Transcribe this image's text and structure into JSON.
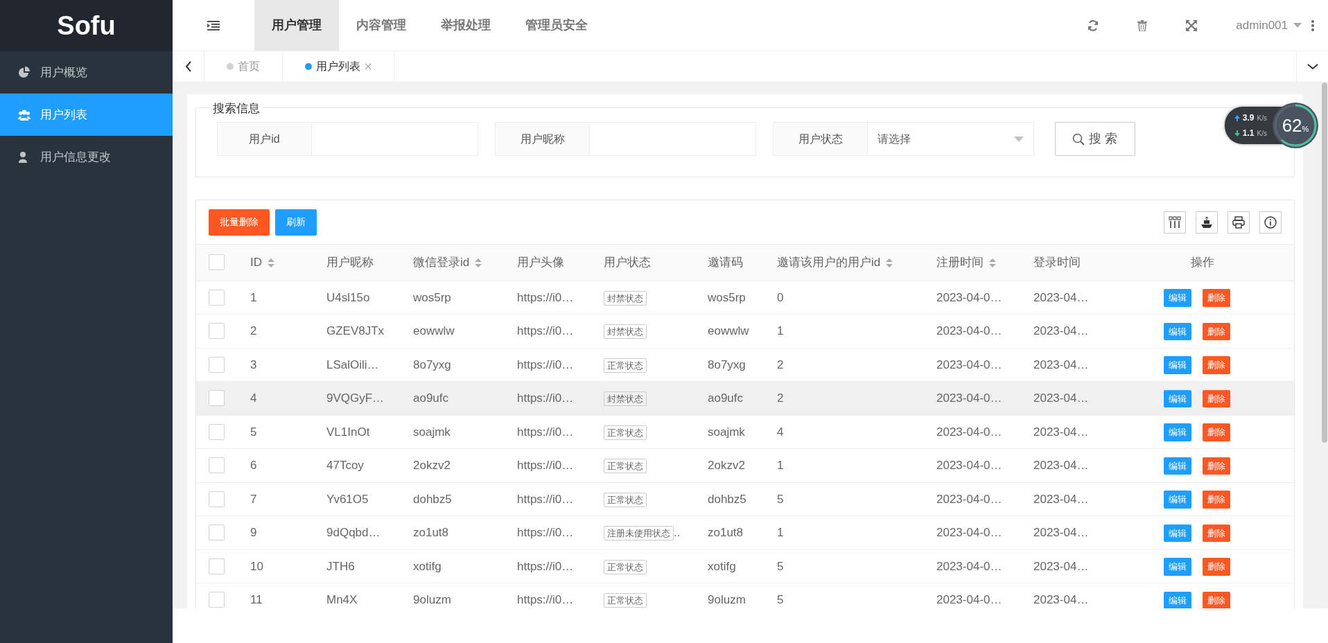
{
  "brand": "Sofu",
  "top_menu": [
    {
      "label": "用户管理",
      "selected": true
    },
    {
      "label": "内容管理",
      "selected": false
    },
    {
      "label": "举报处理",
      "selected": false
    },
    {
      "label": "管理员安全",
      "selected": false
    }
  ],
  "user": "admin001",
  "sidebar": {
    "items": [
      {
        "label": "用户概览",
        "selected": false
      },
      {
        "label": "用户列表",
        "selected": true
      },
      {
        "label": "用户信息更改",
        "selected": false
      }
    ]
  },
  "page_tabs": [
    {
      "label": "首页",
      "selected": false,
      "closable": false
    },
    {
      "label": "用户列表",
      "selected": true,
      "closable": true
    }
  ],
  "search": {
    "legend": "搜索信息",
    "fields": [
      {
        "label": "用户id",
        "kind": "text"
      },
      {
        "label": "用户昵称",
        "kind": "text"
      },
      {
        "label": "用户状态",
        "kind": "select",
        "placeholder": "请选择"
      }
    ],
    "button": "搜 索"
  },
  "toolbar": {
    "buttons": [
      {
        "label": "批量删除",
        "kind": "danger"
      },
      {
        "label": "刷新",
        "kind": "primary"
      }
    ]
  },
  "table": {
    "select_all": {
      "checked": false
    },
    "columns": [
      {
        "label": "ID",
        "sortable": true,
        "kind": "text"
      },
      {
        "label": "用户昵称",
        "sortable": false,
        "kind": "text"
      },
      {
        "label": "微信登录id",
        "sortable": true,
        "kind": "text"
      },
      {
        "label": "用户头像",
        "sortable": false,
        "kind": "text"
      },
      {
        "label": "用户状态",
        "sortable": false,
        "kind": "tag"
      },
      {
        "label": "邀请码",
        "sortable": false,
        "kind": "text"
      },
      {
        "label": "邀请该用户的用户id",
        "sortable": true,
        "kind": "text"
      },
      {
        "label": "注册时间",
        "sortable": true,
        "kind": "text"
      },
      {
        "label": "登录时间",
        "sortable": false,
        "kind": "text"
      },
      {
        "label": "操作",
        "sortable": false,
        "kind": "actions"
      }
    ],
    "rows": [
      {
        "checked": false,
        "hovered": false,
        "cells": [
          "1",
          "U4sl15o",
          "wos5rp",
          "https://i0…",
          "封禁状态",
          "wos5rp",
          "0",
          "2023-04-0…",
          "2023-04…",
          [
            "编辑",
            "删除"
          ]
        ]
      },
      {
        "checked": false,
        "hovered": false,
        "cells": [
          "2",
          "GZEV8JTx",
          "eowwlw",
          "https://i0…",
          "封禁状态",
          "eowwlw",
          "1",
          "2023-04-0…",
          "2023-04…",
          [
            "编辑",
            "删除"
          ]
        ]
      },
      {
        "checked": false,
        "hovered": false,
        "cells": [
          "3",
          "LSalOili…",
          "8o7yxg",
          "https://i0…",
          "正常状态",
          "8o7yxg",
          "2",
          "2023-04-0…",
          "2023-04…",
          [
            "编辑",
            "删除"
          ]
        ]
      },
      {
        "checked": false,
        "hovered": true,
        "cells": [
          "4",
          "9VQGyF…",
          "ao9ufc",
          "https://i0…",
          "封禁状态",
          "ao9ufc",
          "2",
          "2023-04-0…",
          "2023-04…",
          [
            "编辑",
            "删除"
          ]
        ]
      },
      {
        "checked": false,
        "hovered": false,
        "cells": [
          "5",
          "VL1InOt",
          "soajmk",
          "https://i0…",
          "正常状态",
          "soajmk",
          "4",
          "2023-04-0…",
          "2023-04…",
          [
            "编辑",
            "删除"
          ]
        ]
      },
      {
        "checked": false,
        "hovered": false,
        "cells": [
          "6",
          "47Tcoy",
          "2okzv2",
          "https://i0…",
          "正常状态",
          "2okzv2",
          "1",
          "2023-04-0…",
          "2023-04…",
          [
            "编辑",
            "删除"
          ]
        ]
      },
      {
        "checked": false,
        "hovered": false,
        "cells": [
          "7",
          "Yv61O5",
          "dohbz5",
          "https://i0…",
          "正常状态",
          "dohbz5",
          "5",
          "2023-04-0…",
          "2023-04…",
          [
            "编辑",
            "删除"
          ]
        ]
      },
      {
        "checked": false,
        "hovered": false,
        "cells": [
          "9",
          "9dQqbd…",
          "zo1ut8",
          "https://i0…",
          "注册未使用状态 ..",
          "zo1ut8",
          "1",
          "2023-04-0…",
          "2023-04…",
          [
            "编辑",
            "删除"
          ]
        ]
      },
      {
        "checked": false,
        "hovered": false,
        "cells": [
          "10",
          "JTH6",
          "xotifg",
          "https://i0…",
          "正常状态",
          "xotifg",
          "5",
          "2023-04-0…",
          "2023-04…",
          [
            "编辑",
            "删除"
          ]
        ]
      },
      {
        "checked": false,
        "hovered": false,
        "cells": [
          "11",
          "Mn4X",
          "9oluzm",
          "https://i0…",
          "正常状态",
          "9oluzm",
          "5",
          "2023-04-0…",
          "2023-04…",
          [
            "编辑",
            "删除"
          ]
        ]
      }
    ]
  },
  "net_widget": {
    "upload": "3.9",
    "upload_unit": "K/s",
    "download": "1.1",
    "download_unit": "K/s",
    "percent": "62",
    "percent_sign": "%",
    "level": 0.62
  }
}
